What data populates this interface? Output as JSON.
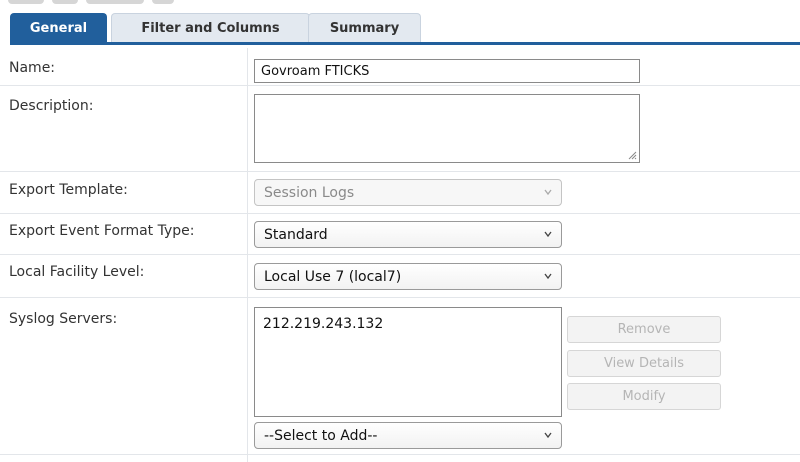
{
  "tabs": [
    {
      "label": "General",
      "active": true
    },
    {
      "label": "Filter and Columns",
      "active": false
    },
    {
      "label": "Summary",
      "active": false
    }
  ],
  "form": {
    "name": {
      "label": "Name:",
      "value": "Govroam FTICKS"
    },
    "description": {
      "label": "Description:",
      "value": ""
    },
    "export_template": {
      "label": "Export Template:",
      "value": "Session Logs",
      "disabled": true
    },
    "export_event_format_type": {
      "label": "Export Event Format Type:",
      "value": "Standard"
    },
    "local_facility_level": {
      "label": "Local Facility Level:",
      "value": "Local Use 7 (local7)"
    },
    "syslog_servers": {
      "label": "Syslog Servers:",
      "items": [
        "212.219.243.132"
      ],
      "add_select": "--Select to Add--",
      "buttons": {
        "remove": "Remove",
        "view_details": "View Details",
        "modify": "Modify"
      }
    }
  },
  "colors": {
    "accent": "#215f9c",
    "tab_inactive": "#e3e9f0",
    "row_divider": "#e3e6ea",
    "disabled_text": "#b5b5b5"
  },
  "icons": {
    "select_arrow": "chevron-down-icon",
    "resize": "resize-grip-icon"
  }
}
